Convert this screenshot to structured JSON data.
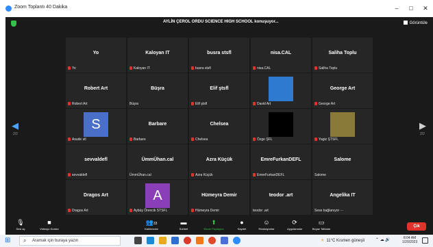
{
  "window": {
    "title": "Zoom Toplantı 40 Dakika",
    "controls": [
      "–",
      "□",
      "✕"
    ]
  },
  "meeting": {
    "speaking_banner": "AYLİN ÇEROL ORDU SCIENCE HIGH SCHOOL konuşuyor...",
    "view_label": "Görüntüle",
    "page_left": "2/2",
    "page_right": "2/2"
  },
  "tiles": [
    {
      "center": "Yo",
      "label": "Yo",
      "muted": true,
      "kind": "name"
    },
    {
      "center": "Kaloyan IT",
      "label": "Kaloyan IT",
      "muted": true,
      "kind": "name"
    },
    {
      "center": "busra stsfl",
      "label": "busra stsfl",
      "muted": true,
      "kind": "name"
    },
    {
      "center": "nisa.CAL",
      "label": "nisa.CAL",
      "muted": true,
      "kind": "name"
    },
    {
      "center": "Saliha Toplu",
      "label": "Saliha Toplu",
      "muted": true,
      "kind": "name"
    },
    {
      "center": "Robert Art",
      "label": "Robert Art",
      "muted": true,
      "kind": "name"
    },
    {
      "center": "Büşra",
      "label": "Büşra",
      "muted": false,
      "kind": "name"
    },
    {
      "center": "Elif ştsfl",
      "label": "Elif ştsfl",
      "muted": true,
      "kind": "name"
    },
    {
      "center": "",
      "label": "David Art",
      "muted": true,
      "kind": "photo",
      "color": "#2f7ad1"
    },
    {
      "center": "George Art",
      "label": "George Art",
      "muted": true,
      "kind": "name"
    },
    {
      "center": "S",
      "label": "Asude stl",
      "muted": true,
      "kind": "avatar",
      "color": "#4a6fc8"
    },
    {
      "center": "Barbare",
      "label": "Barbare",
      "muted": true,
      "kind": "name"
    },
    {
      "center": "Chelsea",
      "label": "Chelsea",
      "muted": true,
      "kind": "name"
    },
    {
      "center": "",
      "label": "Özge ŞFL",
      "muted": true,
      "kind": "photo",
      "color": "#000000"
    },
    {
      "center": "",
      "label": "Yagiz ŞTSFL",
      "muted": true,
      "kind": "photo",
      "color": "#8a7a3a"
    },
    {
      "center": "sevvaldefl",
      "label": "sevvaldefl",
      "muted": true,
      "kind": "name"
    },
    {
      "center": "ÜmmÜhan.cal",
      "label": "ÜmmÜhan.cal",
      "muted": false,
      "kind": "name"
    },
    {
      "center": "Azra Küçük",
      "label": "Azra Küçük",
      "muted": true,
      "kind": "name"
    },
    {
      "center": "EmreFurkanDEFL",
      "label": "EmreFurkanDEFL",
      "muted": true,
      "kind": "name"
    },
    {
      "center": "Salome",
      "label": "Salome",
      "muted": false,
      "kind": "name"
    },
    {
      "center": "Dragos Art",
      "label": "Dragos Art",
      "muted": true,
      "kind": "name"
    },
    {
      "center": "A",
      "label": "Aybüş Örencik STSFL",
      "muted": true,
      "kind": "avatar",
      "color": "#8a3fb8"
    },
    {
      "center": "Hümeyra Demir",
      "label": "Hümeyra Demir",
      "muted": true,
      "kind": "name"
    },
    {
      "center": "teodor .art",
      "label": "teodor .art",
      "muted": false,
      "kind": "name"
    },
    {
      "center": "Angelika IT",
      "label": "Sese bağlanıyor ⋯",
      "muted": false,
      "kind": "name"
    }
  ],
  "toolbar": {
    "audio": "Sesi aç",
    "video": "Videoyu Durdur",
    "participants": "Katılımcılar",
    "participants_count": "33",
    "chat": "Sohbet",
    "share": "Ekran Paylaşımı",
    "record": "Kaydet",
    "reactions": "Reaksiyonlar",
    "apps": "Uygulamalar",
    "whiteboard": "Beyaz Tahtalar",
    "leave": "Çık"
  },
  "taskbar": {
    "search_placeholder": "Aramak için buraya yazın",
    "weather": "11°C  Kısmen güneşli",
    "time": "8:04 AM",
    "date": "1/20/2023"
  }
}
